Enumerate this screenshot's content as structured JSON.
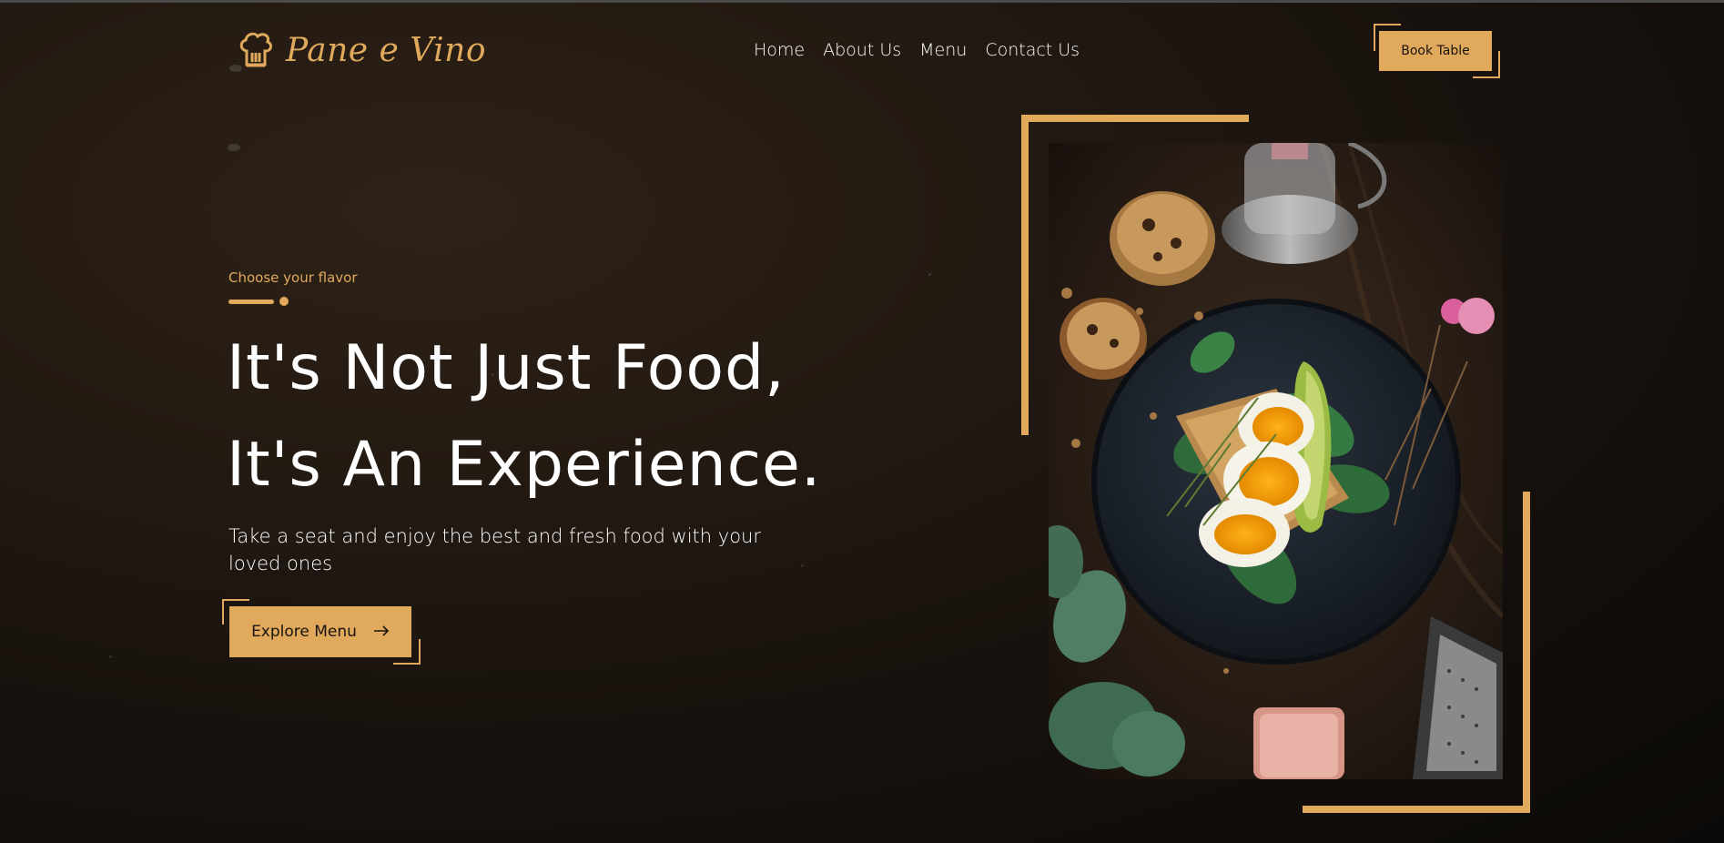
{
  "brand": {
    "name": "Pane e Vino",
    "icon": "chef-hat-icon"
  },
  "nav": {
    "items": [
      "Home",
      "About Us",
      "Menu",
      "Contact Us"
    ]
  },
  "header": {
    "cta_label": "Book Table"
  },
  "hero": {
    "eyebrow": "Choose your flavor",
    "headline_line1": "It's Not Just Food,",
    "headline_line2": "It's An Experience.",
    "tagline": "Take a seat and enjoy the best and fresh food with your loved ones",
    "cta_label": "Explore Menu",
    "cta_icon": "arrow-right-icon"
  },
  "image": {
    "subject": "food-plate-image"
  },
  "colors": {
    "accent": "#e0a95c",
    "background": "#1a1410",
    "text": "#ffffff"
  }
}
